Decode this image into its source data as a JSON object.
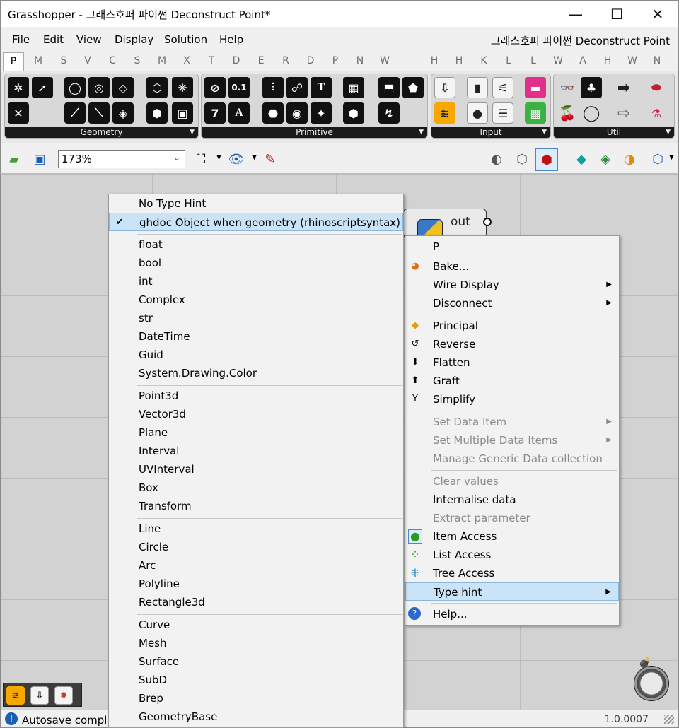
{
  "window": {
    "title": "Grasshopper - 그래스호퍼 파이썬 Deconstruct Point*",
    "minimize": "—",
    "maximize": "☐",
    "close": "✕"
  },
  "menubar": {
    "items": [
      "File",
      "Edit",
      "View",
      "Display",
      "Solution",
      "Help"
    ],
    "document_name": "그래스호퍼 파이썬 Deconstruct Point"
  },
  "tabs": [
    "P",
    "M",
    "S",
    "V",
    "C",
    "S",
    "M",
    "X",
    "T",
    "D",
    "E",
    "R",
    "D",
    "P",
    "N",
    "W",
    "H",
    "H",
    "K",
    "L",
    "L",
    "W",
    "A",
    "H",
    "W",
    "N"
  ],
  "ribbon": {
    "panels": [
      "Geometry",
      "Primitive",
      "Input",
      "Util"
    ],
    "primitive_glyphs": [
      "0.1",
      "7",
      "A",
      "T"
    ]
  },
  "toolbar": {
    "zoom": "173%"
  },
  "component": {
    "output_label": "out"
  },
  "type_menu": {
    "checkmark": "✔",
    "items": [
      "No Type Hint",
      "ghdoc Object when geometry (rhinoscriptsyntax)",
      "float",
      "bool",
      "int",
      "Complex",
      "str",
      "DateTime",
      "Guid",
      "System.Drawing.Color",
      "Point3d",
      "Vector3d",
      "Plane",
      "Interval",
      "UVInterval",
      "Box",
      "Transform",
      "Line",
      "Circle",
      "Arc",
      "Polyline",
      "Rectangle3d",
      "Curve",
      "Mesh",
      "Surface",
      "SubD",
      "Brep",
      "GeometryBase"
    ]
  },
  "context_menu": {
    "items": [
      "P",
      "Bake...",
      "Wire Display",
      "Disconnect",
      "Principal",
      "Reverse",
      "Flatten",
      "Graft",
      "Simplify",
      "Set Data Item",
      "Set Multiple Data Items",
      "Manage Generic Data collection",
      "Clear values",
      "Internalise data",
      "Extract parameter",
      "Item Access",
      "List Access",
      "Tree Access",
      "Type hint",
      "Help..."
    ]
  },
  "statusbar": {
    "text": "Autosave complete",
    "version": "1.0.0007"
  },
  "colors": {
    "accent": "#cbe3f7",
    "ribbon_label_bg": "#1a1a1a",
    "canvas": "#d2d2d2"
  }
}
